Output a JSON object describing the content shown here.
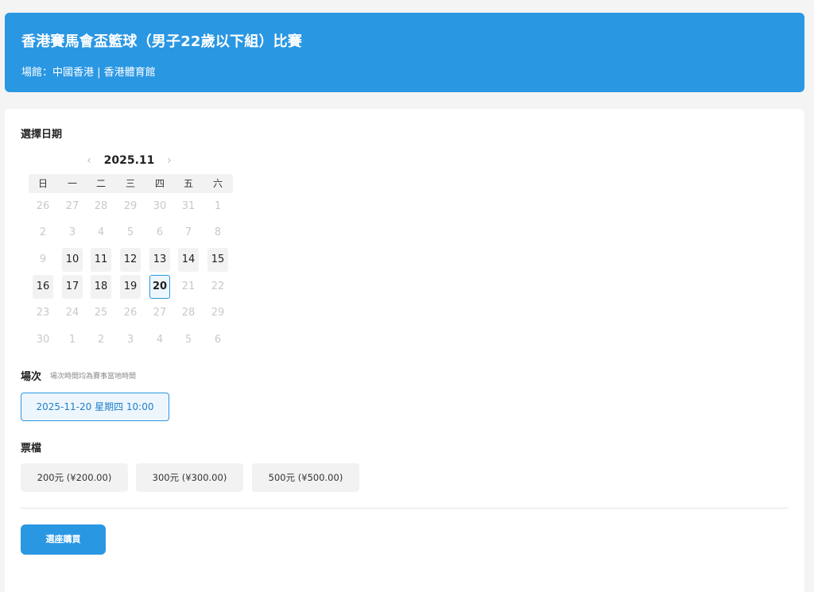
{
  "event": {
    "title": "香港賽馬會盃籃球（男子22歲以下組）比賽",
    "venue": "場館：中國香港 | 香港體育館"
  },
  "date_section": {
    "label": "選擇日期",
    "month": "2025.11",
    "prev_icon": "chevron-left-icon",
    "next_icon": "chevron-right-icon",
    "weekdays": [
      "日",
      "一",
      "二",
      "三",
      "四",
      "五",
      "六"
    ],
    "weeks": [
      [
        {
          "d": "26",
          "s": "muted"
        },
        {
          "d": "27",
          "s": "muted"
        },
        {
          "d": "28",
          "s": "muted"
        },
        {
          "d": "29",
          "s": "muted"
        },
        {
          "d": "30",
          "s": "muted"
        },
        {
          "d": "31",
          "s": "muted"
        },
        {
          "d": "1",
          "s": "muted"
        }
      ],
      [
        {
          "d": "2",
          "s": "muted"
        },
        {
          "d": "3",
          "s": "muted"
        },
        {
          "d": "4",
          "s": "muted"
        },
        {
          "d": "5",
          "s": "muted"
        },
        {
          "d": "6",
          "s": "muted"
        },
        {
          "d": "7",
          "s": "muted"
        },
        {
          "d": "8",
          "s": "muted"
        }
      ],
      [
        {
          "d": "9",
          "s": "muted"
        },
        {
          "d": "10",
          "s": "avail"
        },
        {
          "d": "11",
          "s": "avail"
        },
        {
          "d": "12",
          "s": "avail"
        },
        {
          "d": "13",
          "s": "avail"
        },
        {
          "d": "14",
          "s": "avail"
        },
        {
          "d": "15",
          "s": "avail"
        }
      ],
      [
        {
          "d": "16",
          "s": "avail"
        },
        {
          "d": "17",
          "s": "avail"
        },
        {
          "d": "18",
          "s": "avail"
        },
        {
          "d": "19",
          "s": "avail"
        },
        {
          "d": "20",
          "s": "selected"
        },
        {
          "d": "21",
          "s": "muted"
        },
        {
          "d": "22",
          "s": "muted"
        }
      ],
      [
        {
          "d": "23",
          "s": "muted"
        },
        {
          "d": "24",
          "s": "muted"
        },
        {
          "d": "25",
          "s": "muted"
        },
        {
          "d": "26",
          "s": "muted"
        },
        {
          "d": "27",
          "s": "muted"
        },
        {
          "d": "28",
          "s": "muted"
        },
        {
          "d": "29",
          "s": "muted"
        }
      ],
      [
        {
          "d": "30",
          "s": "muted"
        },
        {
          "d": "1",
          "s": "muted"
        },
        {
          "d": "2",
          "s": "muted"
        },
        {
          "d": "3",
          "s": "muted"
        },
        {
          "d": "4",
          "s": "muted"
        },
        {
          "d": "5",
          "s": "muted"
        },
        {
          "d": "6",
          "s": "muted"
        }
      ]
    ]
  },
  "session_section": {
    "label": "場次",
    "note": "場次時間均為賽事當地時間",
    "selected_session": "2025-11-20 星期四 10:00"
  },
  "ticket_section": {
    "label": "票檔",
    "tiers": [
      "200元 (¥200.00)",
      "300元 (¥300.00)",
      "500元 (¥500.00)"
    ]
  },
  "actions": {
    "buy_label": "選座購買"
  },
  "colors": {
    "accent": "#2a97e3",
    "background": "#f4f4f4"
  }
}
